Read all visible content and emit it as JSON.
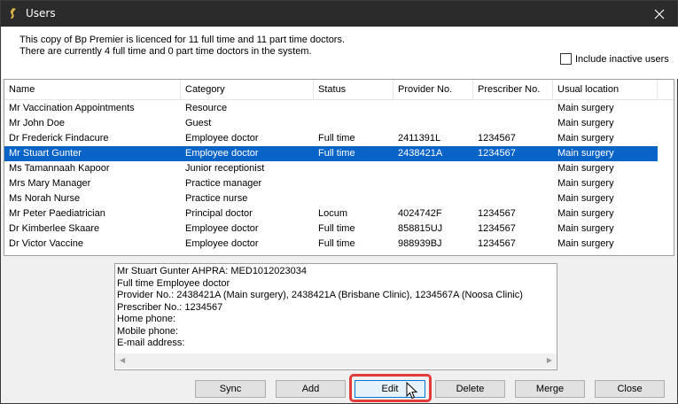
{
  "window": {
    "title": "Users",
    "app_icon": "bp-premier-icon",
    "close_icon": "close-icon"
  },
  "licence": {
    "line1": "This copy of Bp Premier is licenced for 11 full time and 11 part time doctors.",
    "line2": "There are currently 4 full time and 0 part time doctors in the system."
  },
  "include_inactive": {
    "label": "Include inactive users",
    "checked": false
  },
  "table": {
    "columns": [
      "Name",
      "Category",
      "Status",
      "Provider No.",
      "Prescriber No.",
      "Usual location"
    ],
    "rows": [
      [
        "Mr Vaccination Appointments",
        "Resource",
        "",
        "",
        "",
        "Main surgery"
      ],
      [
        "Mr John Doe",
        "Guest",
        "",
        "",
        "",
        "Main surgery"
      ],
      [
        "Dr Frederick Findacure",
        "Employee doctor",
        "Full time",
        "2411391L",
        "1234567",
        "Main surgery"
      ],
      [
        "Mr Stuart Gunter",
        "Employee doctor",
        "Full time",
        "2438421A",
        "1234567",
        "Main surgery"
      ],
      [
        "Ms Tamannaah Kapoor",
        "Junior receptionist",
        "",
        "",
        "",
        "Main surgery"
      ],
      [
        "Mrs Mary Manager",
        "Practice manager",
        "",
        "",
        "",
        "Main surgery"
      ],
      [
        "Ms Norah Nurse",
        "Practice nurse",
        "",
        "",
        "",
        "Main surgery"
      ],
      [
        "Mr Peter Paediatrician",
        "Principal doctor",
        "Locum",
        "4024742F",
        "1234567",
        "Main surgery"
      ],
      [
        "Dr Kimberlee Skaare",
        "Employee doctor",
        "Full time",
        "858815UJ",
        "1234567",
        "Main surgery"
      ],
      [
        "Dr Victor Vaccine",
        "Employee doctor",
        "Full time",
        "988939BJ",
        "1234567",
        "Main surgery"
      ]
    ],
    "selected_index": 3
  },
  "details": {
    "lines": [
      "Mr Stuart Gunter  AHPRA: MED1012023034",
      "Full time Employee doctor",
      "Provider No.:  2438421A (Main surgery), 2438421A (Brisbane Clinic), 1234567A (Noosa Clinic)",
      "Prescriber No.:  1234567",
      "Home phone:",
      "Mobile phone:",
      "E-mail address:"
    ]
  },
  "buttons": {
    "sync": "Sync",
    "add": "Add",
    "edit": "Edit",
    "delete": "Delete",
    "merge": "Merge",
    "close": "Close"
  },
  "colors": {
    "selection": "#0a64c8",
    "highlight": "#e23b3b",
    "titlebar": "#2b2b2b"
  }
}
